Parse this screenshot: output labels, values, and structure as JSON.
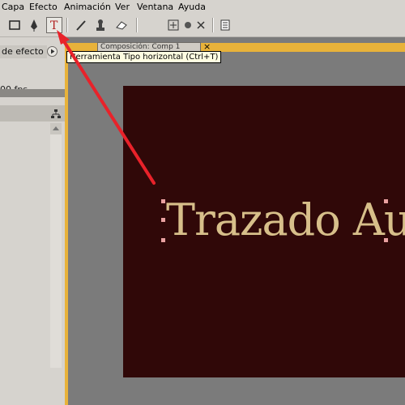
{
  "menubar": {
    "items": [
      "Capa",
      "Efecto",
      "Animación",
      "Ver",
      "Ventana",
      "Ayuda"
    ]
  },
  "toolbar": {
    "tools": [
      "rectangle-tool-icon",
      "pen-tool-icon",
      "type-tool-icon",
      "brush-tool-icon",
      "clone-stamp-icon",
      "eraser-icon",
      "orbit-icon",
      "puppet-pin-icon",
      "puppet-starch-icon",
      "panel-icon"
    ],
    "active_tool": "type-tool-icon"
  },
  "left_panel": {
    "tab_label": "de efecto",
    "fps_text": "00 fps"
  },
  "composition": {
    "tab_label": "Composición: Comp 1",
    "close_glyph": "×",
    "canvas_text": "Trazado Au",
    "frame_color": "#e8b23a",
    "canvas_color": "#300808",
    "text_color": "#d7bf8a"
  },
  "tooltip": {
    "text": "Herramienta Tipo horizontal (Ctrl+T)"
  },
  "annotation": {
    "arrow_color": "#e8222a"
  }
}
